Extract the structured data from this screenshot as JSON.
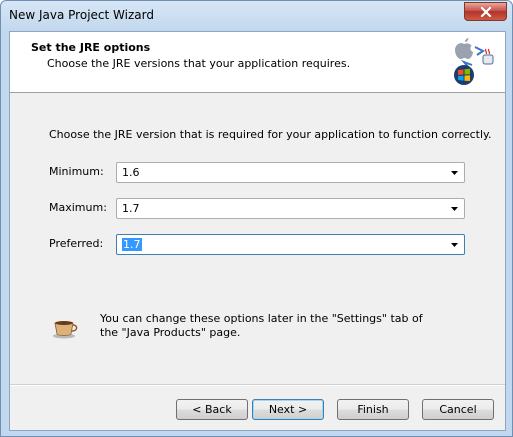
{
  "window": {
    "title": "New Java Project Wizard"
  },
  "header": {
    "title": "Set the JRE options",
    "subtitle": "Choose the JRE versions that your application requires."
  },
  "main": {
    "instructions": "Choose the JRE version that is required for your application to function correctly.",
    "fields": [
      {
        "label": "Minimum:",
        "value": "1.6"
      },
      {
        "label": "Maximum:",
        "value": "1.7"
      },
      {
        "label": "Preferred:",
        "value": "1.7"
      }
    ],
    "info": "You can change these options later in the \"Settings\" tab of the \"Java Products\" page."
  },
  "buttons": {
    "back": "< Back",
    "next": "Next >",
    "finish": "Finish",
    "cancel": "Cancel"
  },
  "icons": {
    "close": "close-icon",
    "header": "platform-logo-icon",
    "info": "coffee-cup-icon",
    "dropdown": "chevron-down-icon"
  }
}
